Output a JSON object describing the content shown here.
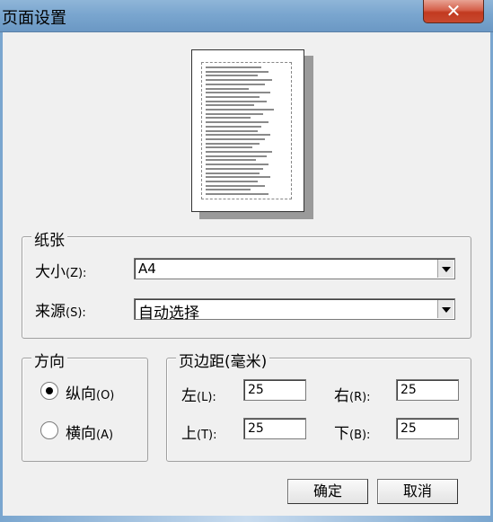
{
  "window": {
    "title": "页面设置",
    "close_glyph": "✕"
  },
  "paper": {
    "group_label": "纸张",
    "size_label": "大小",
    "size_key": "(Z):",
    "size_value": "A4",
    "source_label": "来源",
    "source_key": "(S):",
    "source_value": "自动选择"
  },
  "orientation": {
    "group_label": "方向",
    "portrait_label": "纵向",
    "portrait_key": "(O)",
    "landscape_label": "横向",
    "landscape_key": "(A)",
    "selected": "portrait"
  },
  "margins": {
    "group_label": "页边距(毫米)",
    "left_label": "左",
    "left_key": "(L):",
    "left_value": "25",
    "right_label": "右",
    "right_key": "(R):",
    "right_value": "25",
    "top_label": "上",
    "top_key": "(T):",
    "top_value": "25",
    "bottom_label": "下",
    "bottom_key": "(B):",
    "bottom_value": "25"
  },
  "buttons": {
    "ok_label": "确定",
    "cancel_label": "取消"
  }
}
